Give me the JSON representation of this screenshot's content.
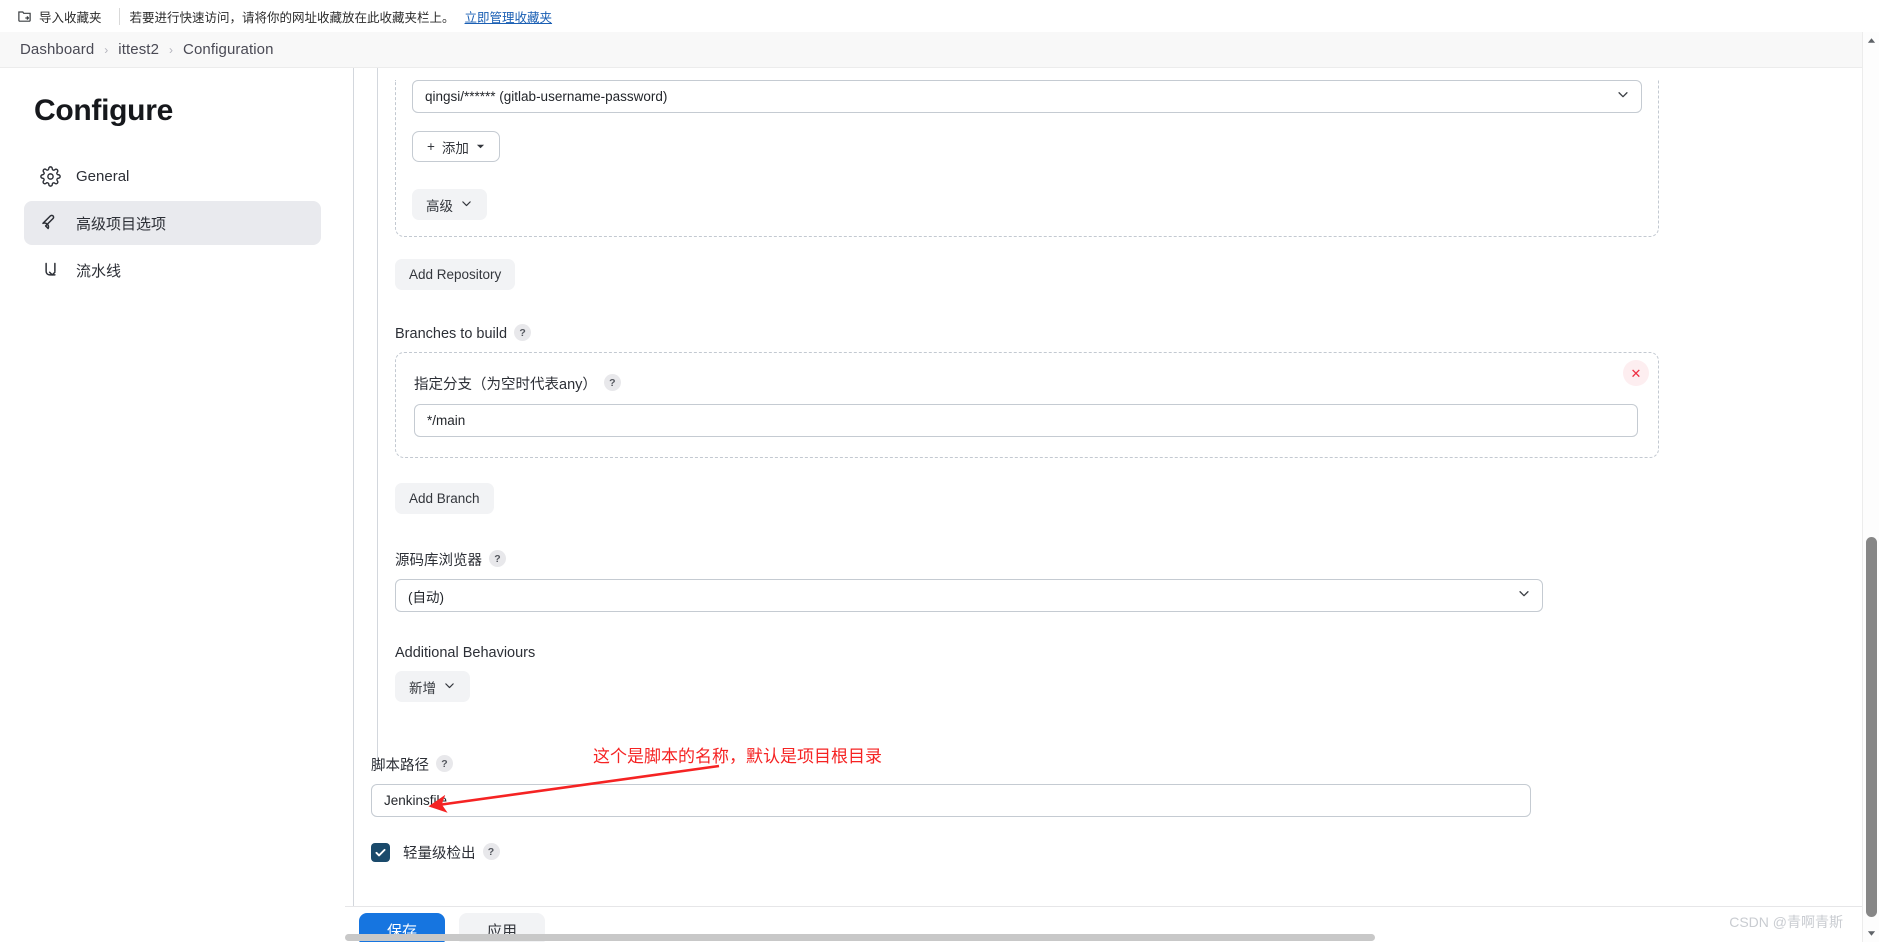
{
  "browser": {
    "bookmark_bar": {
      "import_label": "导入收藏夹",
      "hint": "若要进行快速访问，请将你的网址收藏放在此收藏夹栏上。",
      "manage_link": "立即管理收藏夹"
    }
  },
  "breadcrumb": {
    "items": [
      "Dashboard",
      "ittest2",
      "Configuration"
    ],
    "separator": "›"
  },
  "sidebar": {
    "title": "Configure",
    "items": [
      {
        "label": "General",
        "icon": "gear-icon",
        "active": false
      },
      {
        "label": "高级项目选项",
        "icon": "wrench-icon",
        "active": true
      },
      {
        "label": "流水线",
        "icon": "pipeline-icon",
        "active": false
      }
    ]
  },
  "form": {
    "credentials": {
      "selected": "qingsi/****** (gitlab-username-password)",
      "add_button": "添加",
      "add_prefix": "+",
      "advanced_button": "高级"
    },
    "add_repository_button": "Add Repository",
    "branches": {
      "label": "Branches to build",
      "help": "?",
      "specifier_label": "指定分支（为空时代表any）",
      "specifier_help": "?",
      "specifier_value": "*/main",
      "remove_icon": "✕",
      "add_branch_button": "Add Branch"
    },
    "repo_browser": {
      "label": "源码库浏览器",
      "help": "?",
      "selected": "(自动)"
    },
    "additional_behaviours": {
      "label": "Additional Behaviours",
      "add_button": "新增"
    },
    "script_path": {
      "label": "脚本路径",
      "help": "?",
      "value": "Jenkinsfile"
    },
    "lightweight_checkout": {
      "label": "轻量级检出",
      "help": "?",
      "checked": true
    }
  },
  "annotation": {
    "text": "这个是脚本的名称，默认是项目根目录",
    "color": "#f52323"
  },
  "footer": {
    "save_label": "保存",
    "apply_label": "应用",
    "save_color": "#1675e0"
  },
  "watermark": "CSDN @青啊青斯"
}
